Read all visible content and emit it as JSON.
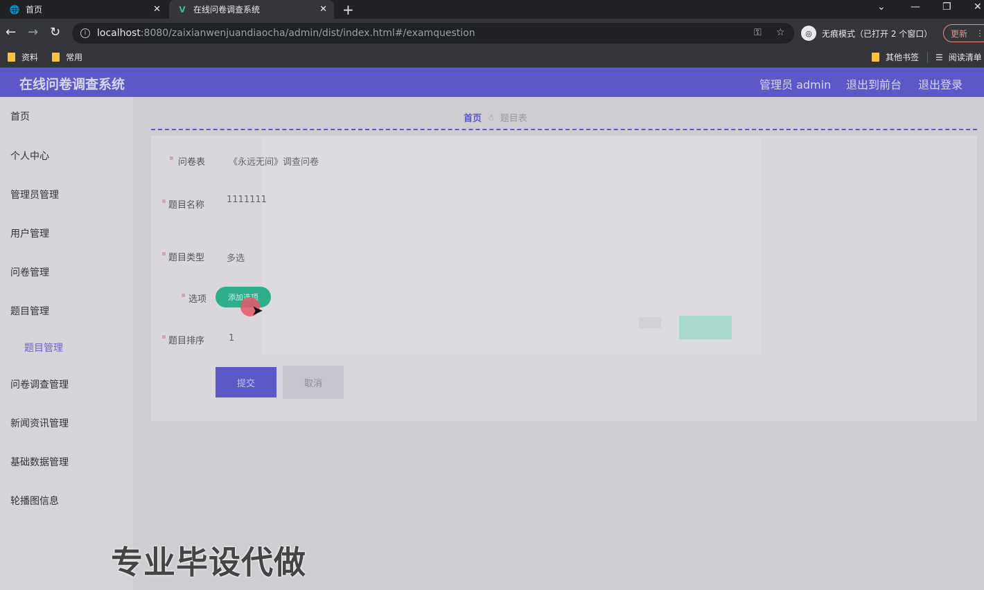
{
  "browser": {
    "tabs": [
      {
        "title": "首页"
      },
      {
        "title": "在线问卷调查系统"
      }
    ],
    "url_host": "localhost",
    "url_path": ":8080/zaixianwenjuandiaocha/admin/dist/index.html#/examquestion",
    "incognito_label": "无痕模式（已打开 2 个窗口）",
    "update_label": "更新",
    "bookmarks": [
      {
        "label": "资料"
      },
      {
        "label": "常用"
      },
      {
        "label": "其他书签"
      },
      {
        "label": "阅读清单"
      }
    ]
  },
  "header": {
    "title": "在线问卷调查系统",
    "user": "管理员 admin",
    "to_front": "退出到前台",
    "logout": "退出登录"
  },
  "sidebar": {
    "items": [
      {
        "label": "首页"
      },
      {
        "label": "个人中心"
      },
      {
        "label": "管理员管理"
      },
      {
        "label": "用户管理"
      },
      {
        "label": "问卷管理"
      },
      {
        "label": "题目管理"
      },
      {
        "label": "题目管理"
      },
      {
        "label": "问卷调查管理"
      },
      {
        "label": "新闻资讯管理"
      },
      {
        "label": "基础数据管理"
      },
      {
        "label": "轮播图信息"
      }
    ]
  },
  "breadcrumb": {
    "home": "首页",
    "current": "题目表"
  },
  "form": {
    "questionnaire_label": "问卷表",
    "questionnaire_value": "《永远无间》调查问卷",
    "name_label": "题目名称",
    "name_value": "1111111",
    "type_label": "题目类型",
    "type_value": "多选",
    "options_label": "选项",
    "add_option": "添加选项",
    "order_label": "题目排序",
    "order_value": "1",
    "submit": "提交",
    "cancel": "取消"
  },
  "watermark": "专业毕设代做"
}
